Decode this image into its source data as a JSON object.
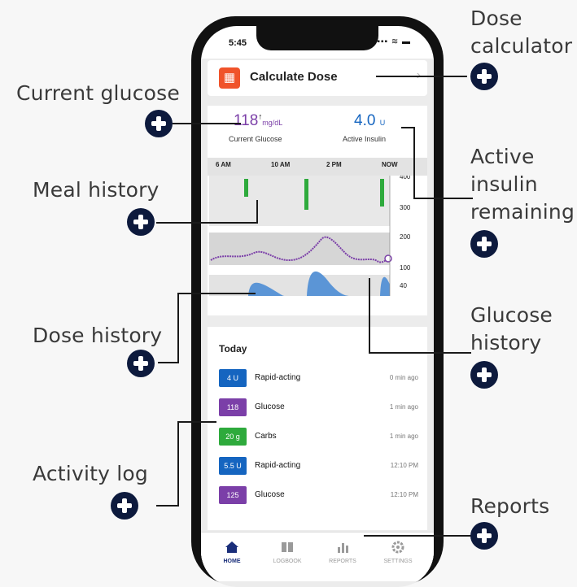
{
  "status_bar": {
    "time": "5:45",
    "icons": "▪▪▪ ≋ ▬"
  },
  "calc": {
    "icon": "calculator-icon",
    "title": "Calculate Dose",
    "chevron": "›"
  },
  "glucose": {
    "value": "118",
    "arrow": "↑",
    "unit": "mg/dL",
    "label": "Current Glucose"
  },
  "insulin": {
    "value": "4.0",
    "unit": "U",
    "label": "Active Insulin"
  },
  "chart_axis": {
    "times": [
      "6 AM",
      "10 AM",
      "2 PM",
      "NOW"
    ],
    "levels": [
      "400",
      "300",
      "200",
      "100",
      "40"
    ]
  },
  "log": {
    "heading": "Today",
    "items": [
      {
        "badge": "4 U",
        "label": "Rapid-acting",
        "time": "0 min ago",
        "color": "#1565c0"
      },
      {
        "badge": "118",
        "label": "Glucose",
        "time": "1 min ago",
        "color": "#7b3fa8"
      },
      {
        "badge": "20 g",
        "label": "Carbs",
        "time": "1 min ago",
        "color": "#2eaa3c"
      },
      {
        "badge": "5.5 U",
        "label": "Rapid-acting",
        "time": "12:10 PM",
        "color": "#1565c0"
      },
      {
        "badge": "125",
        "label": "Glucose",
        "time": "12:10 PM",
        "color": "#7b3fa8"
      }
    ]
  },
  "tabs": [
    {
      "label": "HOME",
      "icon": "home-icon"
    },
    {
      "label": "LOGBOOK",
      "icon": "book-icon"
    },
    {
      "label": "REPORTS",
      "icon": "bar-chart-icon"
    },
    {
      "label": "SETTINGS",
      "icon": "gear-icon"
    }
  ],
  "callouts": {
    "dose_calculator": "Dose\ncalculator",
    "current_glucose": "Current glucose",
    "meal_history": "Meal history",
    "active_insulin": "Active\ninsulin\nremaining",
    "dose_history": "Dose history",
    "glucose_history": "Glucose\nhistory",
    "activity_log": "Activity log",
    "reports": "Reports"
  },
  "colors": {
    "accent_orange": "#f0532a",
    "glucose_purple": "#7b3fa8",
    "insulin_blue": "#1565c0",
    "carb_green": "#2eaa3c",
    "callout_navy": "#0d1a3d"
  }
}
